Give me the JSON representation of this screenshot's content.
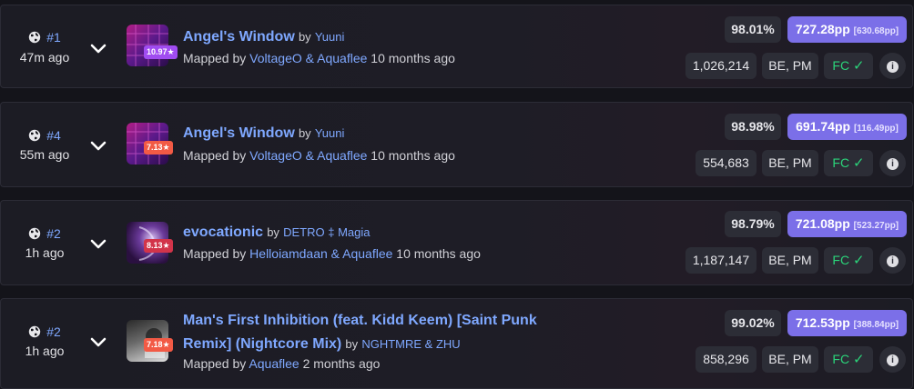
{
  "scores": [
    {
      "rank": "#1",
      "ago": "47m ago",
      "title": "Angel's Window",
      "by": "by",
      "artist": "Yuuni",
      "mapped_label": "Mapped by",
      "mapper": "VoltageO & Aquaflee",
      "mapped_ago": "10 months ago",
      "stars": "10.97★",
      "stars_color": "#a04cf0",
      "accuracy": "98.01%",
      "pp": "727.28pp",
      "pp_raw": "[630.68pp]",
      "score": "1,026,214",
      "mods": "BE, PM",
      "fc": "FC"
    },
    {
      "rank": "#4",
      "ago": "55m ago",
      "title": "Angel's Window",
      "by": "by",
      "artist": "Yuuni",
      "mapped_label": "Mapped by",
      "mapper": "VoltageO & Aquaflee",
      "mapped_ago": "10 months ago",
      "stars": "7.13★",
      "stars_color": "#f25a45",
      "accuracy": "98.98%",
      "pp": "691.74pp",
      "pp_raw": "[116.49pp]",
      "score": "554,683",
      "mods": "BE, PM",
      "fc": "FC"
    },
    {
      "rank": "#2",
      "ago": "1h ago",
      "title": "evocationic",
      "by": "by",
      "artist": "DETRO ‡ Magia",
      "mapped_label": "Mapped by",
      "mapper": "Helloiamdaan & Aquaflee",
      "mapped_ago": "10 months ago",
      "stars": "8.13★",
      "stars_color": "#d2344a",
      "accuracy": "98.79%",
      "pp": "721.08pp",
      "pp_raw": "[523.27pp]",
      "score": "1,187,147",
      "mods": "BE, PM",
      "fc": "FC"
    },
    {
      "rank": "#2",
      "ago": "1h ago",
      "title": "Man's First Inhibition (feat. Kidd Keem) [Saint Punk",
      "title2": "Remix] (Nightcore Mix)",
      "by": "by",
      "artist": "NGHTMRE & ZHU",
      "mapped_label": "Mapped by",
      "mapper": "Aquaflee",
      "mapped_ago": "2 months ago",
      "stars": "7.18★",
      "stars_color": "#f25a45",
      "accuracy": "99.02%",
      "pp": "712.53pp",
      "pp_raw": "[388.84pp]",
      "score": "858,296",
      "mods": "BE, PM",
      "fc": "FC"
    }
  ],
  "icons": {
    "globe": "globe-icon",
    "chevron": "chevron-down-icon",
    "check": "check-icon",
    "info": "info-icon"
  },
  "colors": {
    "link": "#7fa8ff",
    "pp_bg": "#7b6fe8",
    "pill_bg": "#2c2d36",
    "fc_green": "#2bd47a"
  }
}
